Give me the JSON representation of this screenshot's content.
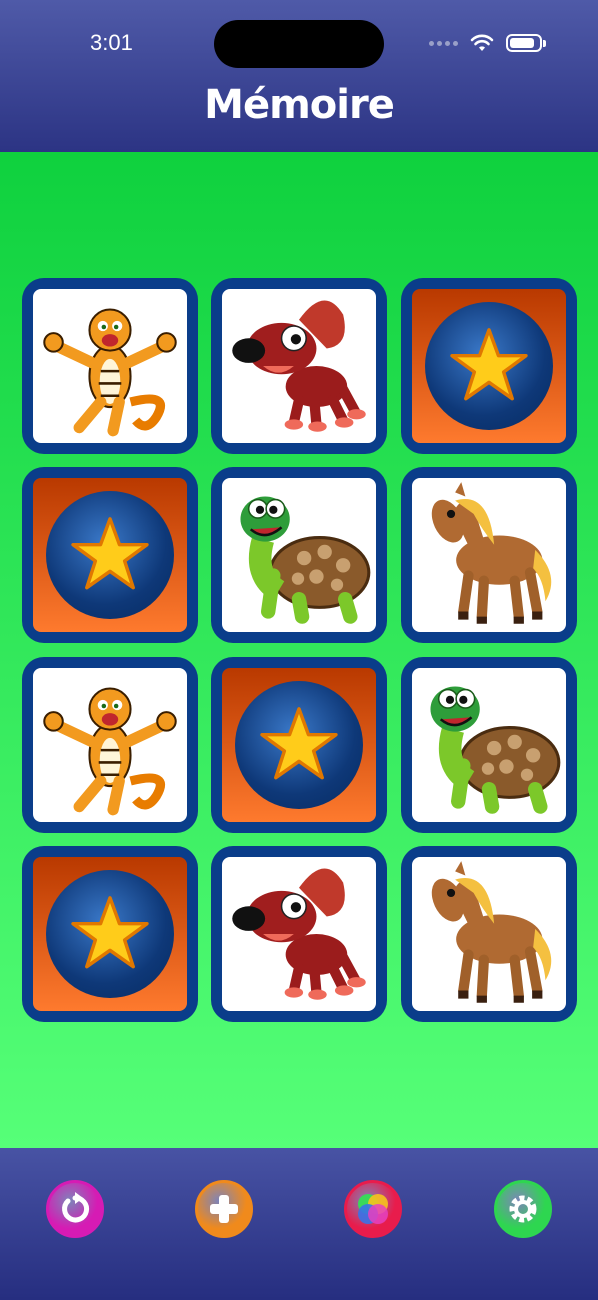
{
  "status": {
    "time": "3:01",
    "battery_level": 0.85
  },
  "header": {
    "title": "Mémoire"
  },
  "board": {
    "cards": [
      {
        "state": "face-up",
        "animal": "tiger"
      },
      {
        "state": "face-up",
        "animal": "dog"
      },
      {
        "state": "face-down",
        "animal": ""
      },
      {
        "state": "face-down",
        "animal": ""
      },
      {
        "state": "face-up",
        "animal": "turtle"
      },
      {
        "state": "face-up",
        "animal": "horse"
      },
      {
        "state": "face-up",
        "animal": "tiger"
      },
      {
        "state": "face-down",
        "animal": ""
      },
      {
        "state": "face-up",
        "animal": "turtle"
      },
      {
        "state": "face-down",
        "animal": ""
      },
      {
        "state": "face-up",
        "animal": "dog"
      },
      {
        "state": "face-up",
        "animal": "horse"
      }
    ]
  },
  "footer": {
    "buttons": [
      {
        "name": "restart-icon",
        "color": "#d61bb4"
      },
      {
        "name": "add-icon",
        "color": "#f08a1c"
      },
      {
        "name": "themes-icon",
        "color": "#e81c4c"
      },
      {
        "name": "settings-icon",
        "color": "#2ed650"
      }
    ]
  },
  "colors": {
    "header": "#3a4396",
    "board_top": "#0fd13e",
    "board_bottom": "#56ff78",
    "card_border": "#0a3d8a"
  }
}
